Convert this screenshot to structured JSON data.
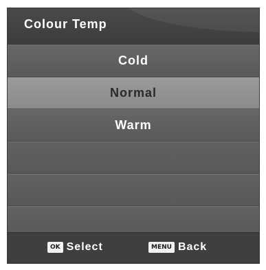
{
  "menu": {
    "title": "Colour Temp",
    "options": [
      {
        "label": "Cold",
        "selected": false
      },
      {
        "label": "Normal",
        "selected": true
      },
      {
        "label": "Warm",
        "selected": false
      }
    ],
    "empty_rows": 3
  },
  "footer": {
    "select_key": "OK",
    "select_label": "Select",
    "back_key": "MENU",
    "back_label": "Back"
  },
  "colors": {
    "panel": "#5c5c5c",
    "header": "#404040",
    "selected_row": "#929292",
    "footer": "#3f3f3f",
    "text": "#ffffff"
  }
}
